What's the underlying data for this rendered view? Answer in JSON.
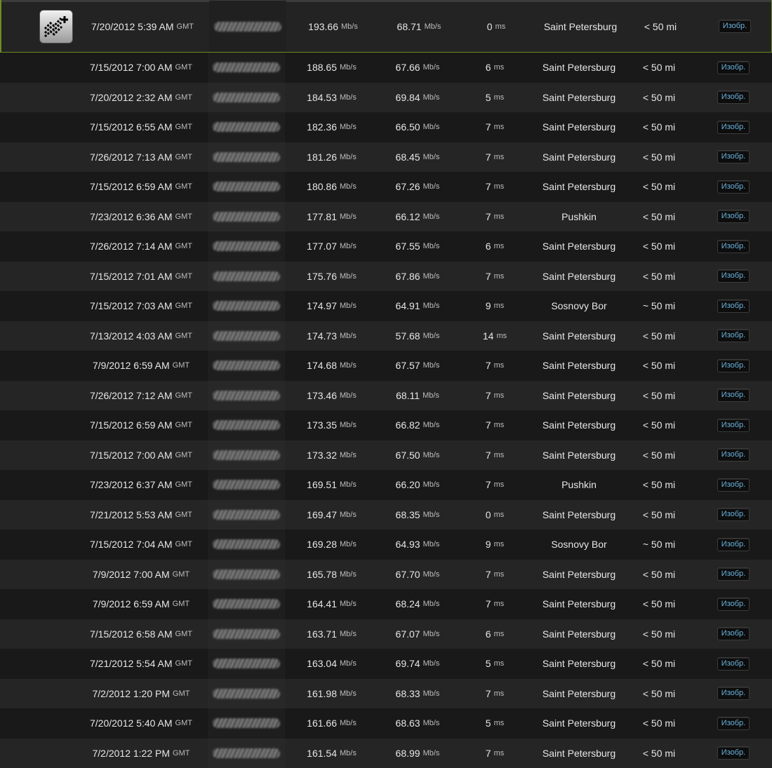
{
  "unit_speed": "Mb/s",
  "unit_ping": "ms",
  "icon": "speedtest-add-icon",
  "accent": "#6c8e22",
  "button_color": "#6ab2dc",
  "rows": [
    {
      "date": "7/20/2012 5:39 AM",
      "tz": "GMT",
      "download": "193.66",
      "upload": "68.71",
      "ping": "0",
      "server": "Saint Petersburg",
      "distance": "< 50 mi",
      "button": "Изобр."
    },
    {
      "date": "7/15/2012 7:00 AM",
      "tz": "GMT",
      "download": "188.65",
      "upload": "67.66",
      "ping": "6",
      "server": "Saint Petersburg",
      "distance": "< 50 mi",
      "button": "Изобр."
    },
    {
      "date": "7/20/2012 2:32 AM",
      "tz": "GMT",
      "download": "184.53",
      "upload": "69.84",
      "ping": "5",
      "server": "Saint Petersburg",
      "distance": "< 50 mi",
      "button": "Изобр."
    },
    {
      "date": "7/15/2012 6:55 AM",
      "tz": "GMT",
      "download": "182.36",
      "upload": "66.50",
      "ping": "7",
      "server": "Saint Petersburg",
      "distance": "< 50 mi",
      "button": "Изобр."
    },
    {
      "date": "7/26/2012 7:13 AM",
      "tz": "GMT",
      "download": "181.26",
      "upload": "68.45",
      "ping": "7",
      "server": "Saint Petersburg",
      "distance": "< 50 mi",
      "button": "Изобр."
    },
    {
      "date": "7/15/2012 6:59 AM",
      "tz": "GMT",
      "download": "180.86",
      "upload": "67.26",
      "ping": "7",
      "server": "Saint Petersburg",
      "distance": "< 50 mi",
      "button": "Изобр."
    },
    {
      "date": "7/23/2012 6:36 AM",
      "tz": "GMT",
      "download": "177.81",
      "upload": "66.12",
      "ping": "7",
      "server": "Pushkin",
      "distance": "< 50 mi",
      "button": "Изобр."
    },
    {
      "date": "7/26/2012 7:14 AM",
      "tz": "GMT",
      "download": "177.07",
      "upload": "67.55",
      "ping": "6",
      "server": "Saint Petersburg",
      "distance": "< 50 mi",
      "button": "Изобр."
    },
    {
      "date": "7/15/2012 7:01 AM",
      "tz": "GMT",
      "download": "175.76",
      "upload": "67.86",
      "ping": "7",
      "server": "Saint Petersburg",
      "distance": "< 50 mi",
      "button": "Изобр."
    },
    {
      "date": "7/15/2012 7:03 AM",
      "tz": "GMT",
      "download": "174.97",
      "upload": "64.91",
      "ping": "9",
      "server": "Sosnovy Bor",
      "distance": "~ 50 mi",
      "button": "Изобр."
    },
    {
      "date": "7/13/2012 4:03 AM",
      "tz": "GMT",
      "download": "174.73",
      "upload": "57.68",
      "ping": "14",
      "server": "Saint Petersburg",
      "distance": "< 50 mi",
      "button": "Изобр."
    },
    {
      "date": "7/9/2012 6:59 AM",
      "tz": "GMT",
      "download": "174.68",
      "upload": "67.57",
      "ping": "7",
      "server": "Saint Petersburg",
      "distance": "< 50 mi",
      "button": "Изобр."
    },
    {
      "date": "7/26/2012 7:12 AM",
      "tz": "GMT",
      "download": "173.46",
      "upload": "68.11",
      "ping": "7",
      "server": "Saint Petersburg",
      "distance": "< 50 mi",
      "button": "Изобр."
    },
    {
      "date": "7/15/2012 6:59 AM",
      "tz": "GMT",
      "download": "173.35",
      "upload": "66.82",
      "ping": "7",
      "server": "Saint Petersburg",
      "distance": "< 50 mi",
      "button": "Изобр."
    },
    {
      "date": "7/15/2012 7:00 AM",
      "tz": "GMT",
      "download": "173.32",
      "upload": "67.50",
      "ping": "7",
      "server": "Saint Petersburg",
      "distance": "< 50 mi",
      "button": "Изобр."
    },
    {
      "date": "7/23/2012 6:37 AM",
      "tz": "GMT",
      "download": "169.51",
      "upload": "66.20",
      "ping": "7",
      "server": "Pushkin",
      "distance": "< 50 mi",
      "button": "Изобр."
    },
    {
      "date": "7/21/2012 5:53 AM",
      "tz": "GMT",
      "download": "169.47",
      "upload": "68.35",
      "ping": "0",
      "server": "Saint Petersburg",
      "distance": "< 50 mi",
      "button": "Изобр."
    },
    {
      "date": "7/15/2012 7:04 AM",
      "tz": "GMT",
      "download": "169.28",
      "upload": "64.93",
      "ping": "9",
      "server": "Sosnovy Bor",
      "distance": "~ 50 mi",
      "button": "Изобр."
    },
    {
      "date": "7/9/2012 7:00 AM",
      "tz": "GMT",
      "download": "165.78",
      "upload": "67.70",
      "ping": "7",
      "server": "Saint Petersburg",
      "distance": "< 50 mi",
      "button": "Изобр."
    },
    {
      "date": "7/9/2012 6:59 AM",
      "tz": "GMT",
      "download": "164.41",
      "upload": "68.24",
      "ping": "7",
      "server": "Saint Petersburg",
      "distance": "< 50 mi",
      "button": "Изобр."
    },
    {
      "date": "7/15/2012 6:58 AM",
      "tz": "GMT",
      "download": "163.71",
      "upload": "67.07",
      "ping": "6",
      "server": "Saint Petersburg",
      "distance": "< 50 mi",
      "button": "Изобр."
    },
    {
      "date": "7/21/2012 5:54 AM",
      "tz": "GMT",
      "download": "163.04",
      "upload": "69.74",
      "ping": "5",
      "server": "Saint Petersburg",
      "distance": "< 50 mi",
      "button": "Изобр."
    },
    {
      "date": "7/2/2012 1:20 PM",
      "tz": "GMT",
      "download": "161.98",
      "upload": "68.33",
      "ping": "7",
      "server": "Saint Petersburg",
      "distance": "< 50 mi",
      "button": "Изобр."
    },
    {
      "date": "7/20/2012 5:40 AM",
      "tz": "GMT",
      "download": "161.66",
      "upload": "68.63",
      "ping": "5",
      "server": "Saint Petersburg",
      "distance": "< 50 mi",
      "button": "Изобр."
    },
    {
      "date": "7/2/2012 1:22 PM",
      "tz": "GMT",
      "download": "161.54",
      "upload": "68.99",
      "ping": "7",
      "server": "Saint Petersburg",
      "distance": "< 50 mi",
      "button": "Изобр."
    }
  ]
}
